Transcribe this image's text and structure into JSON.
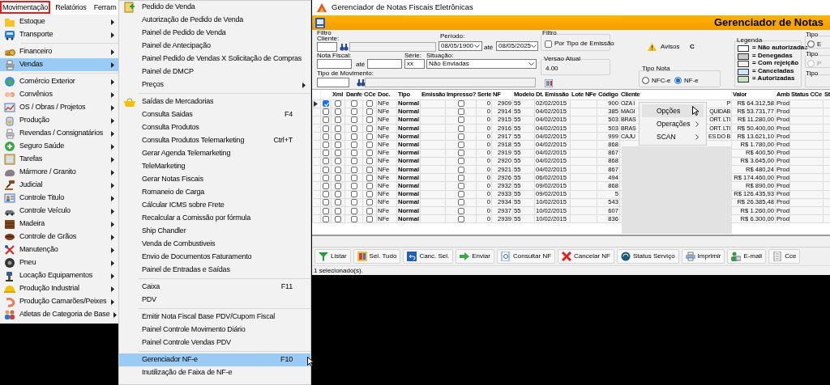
{
  "menubar": [
    {
      "label": "Movimentação",
      "selected": true
    },
    {
      "label": "Relatórios",
      "selected": false
    },
    {
      "label": "Ferram",
      "selected": false
    }
  ],
  "main_menu": [
    {
      "kind": "item",
      "label": "Estoque",
      "has_submenu": true,
      "selected": false
    },
    {
      "kind": "item",
      "label": "Transporte",
      "has_submenu": true,
      "selected": false
    },
    {
      "kind": "separator"
    },
    {
      "kind": "item",
      "label": "Financeiro",
      "has_submenu": true,
      "selected": false
    },
    {
      "kind": "item",
      "label": "Vendas",
      "has_submenu": true,
      "selected": true
    },
    {
      "kind": "separator"
    },
    {
      "kind": "item",
      "label": "Comércio Exterior",
      "has_submenu": true,
      "selected": false
    },
    {
      "kind": "item",
      "label": "Convênios",
      "has_submenu": true,
      "selected": false
    },
    {
      "kind": "item",
      "label": "OS / Obras / Projetos",
      "has_submenu": true,
      "selected": false
    },
    {
      "kind": "item",
      "label": "Produção",
      "has_submenu": true,
      "selected": false
    },
    {
      "kind": "item",
      "label": "Revendas / Consignatários",
      "has_submenu": true,
      "selected": false
    },
    {
      "kind": "item",
      "label": "Seguro Saúde",
      "has_submenu": true,
      "selected": false
    },
    {
      "kind": "item",
      "label": "Tarefas",
      "has_submenu": true,
      "selected": false
    },
    {
      "kind": "item",
      "label": "Mármore / Granito",
      "has_submenu": true,
      "selected": false
    },
    {
      "kind": "item",
      "label": "Judicial",
      "has_submenu": true,
      "selected": false
    },
    {
      "kind": "item",
      "label": "Controle Titulo",
      "has_submenu": true,
      "selected": false
    },
    {
      "kind": "item",
      "label": "Controle Veículo",
      "has_submenu": true,
      "selected": false
    },
    {
      "kind": "item",
      "label": "Madeira",
      "has_submenu": true,
      "selected": false
    },
    {
      "kind": "item",
      "label": "Controle de Grãos",
      "has_submenu": true,
      "selected": false
    },
    {
      "kind": "item",
      "label": "Manutenção",
      "has_submenu": true,
      "selected": false
    },
    {
      "kind": "item",
      "label": "Pneu",
      "has_submenu": true,
      "selected": false
    },
    {
      "kind": "item",
      "label": "Locação Equipamentos",
      "has_submenu": true,
      "selected": false
    },
    {
      "kind": "item",
      "label": "Produção Industrial",
      "has_submenu": true,
      "selected": false
    },
    {
      "kind": "item",
      "label": "Produção Camarões/Peixes",
      "has_submenu": true,
      "selected": false
    },
    {
      "kind": "item",
      "label": "Atletas de Categoria de Base",
      "has_submenu": true,
      "selected": false
    }
  ],
  "submenu": [
    {
      "kind": "item",
      "label": "Pedido de Venda",
      "has_icon": true,
      "selected": false
    },
    {
      "kind": "item",
      "label": "Autorização de Pedido de Venda",
      "selected": false
    },
    {
      "kind": "item",
      "label": "Painel de Pedido de Venda",
      "selected": false
    },
    {
      "kind": "item",
      "label": "Painel de Antecipação",
      "selected": false
    },
    {
      "kind": "item",
      "label": "Painel Pedido de Vendas X Solicitação de Compras",
      "selected": false
    },
    {
      "kind": "item",
      "label": "Painel de DMCP",
      "selected": false
    },
    {
      "kind": "item",
      "label": "Preços",
      "has_submenu": true,
      "selected": false
    },
    {
      "kind": "separator"
    },
    {
      "kind": "item",
      "label": "Saídas de Mercadorias",
      "has_icon": true,
      "selected": false
    },
    {
      "kind": "item",
      "label": "Consulta Saidas",
      "shortcut": "F4",
      "selected": false
    },
    {
      "kind": "item",
      "label": "Consulta Produtos",
      "selected": false
    },
    {
      "kind": "item",
      "label": "Consulta Produtos Telemarketing",
      "shortcut": "Ctrl+T",
      "selected": false
    },
    {
      "kind": "item",
      "label": "Gerar Agenda Telemarketing",
      "selected": false
    },
    {
      "kind": "item",
      "label": "TeleMarketing",
      "selected": false
    },
    {
      "kind": "item",
      "label": "Gerar Notas Fiscais",
      "selected": false
    },
    {
      "kind": "item",
      "label": "Romaneio de Carga",
      "selected": false
    },
    {
      "kind": "item",
      "label": "Cálcular ICMS sobre Frete",
      "selected": false
    },
    {
      "kind": "item",
      "label": "Recalcular a Comissão por fórmula",
      "selected": false
    },
    {
      "kind": "item",
      "label": "Ship Chandler",
      "selected": false
    },
    {
      "kind": "item",
      "label": "Venda de Combustiveis",
      "selected": false
    },
    {
      "kind": "item",
      "label": "Envio de Documentos Faturamento",
      "selected": false
    },
    {
      "kind": "item",
      "label": "Painel de Entradas e Saídas",
      "selected": false
    },
    {
      "kind": "separator"
    },
    {
      "kind": "item",
      "label": "Caixa",
      "shortcut": "F11",
      "selected": false
    },
    {
      "kind": "item",
      "label": "PDV",
      "selected": false
    },
    {
      "kind": "separator"
    },
    {
      "kind": "item",
      "label": "Emitir Nota Fiscal Base PDV/Cupom Fiscal",
      "selected": false
    },
    {
      "kind": "item",
      "label": "Painel Controle Movimento Diário",
      "selected": false
    },
    {
      "kind": "item",
      "label": "Painel Controle Vendas PDV",
      "selected": false
    },
    {
      "kind": "separator"
    },
    {
      "kind": "item",
      "label": "Gerenciador NF-e",
      "shortcut": "F10",
      "selected": true
    },
    {
      "kind": "item",
      "label": "Inutilização de Faixa de NF-e",
      "selected": false
    }
  ],
  "window": {
    "title": "Gerenciador de Notas Fiscais Eletrônicas",
    "header": "Gerenciador de Notas",
    "filter": {
      "group_label": "Filtro",
      "cliente_label": "Cliente:",
      "periodo_label": "Período:",
      "date_from": "08/05/1900",
      "ate_1": "até",
      "date_to": "08/05/2025",
      "emission_group": "Filtro",
      "emission_checkbox": {
        "label": "Por Tipo de Emissão",
        "checked": false
      },
      "nota_label": "Nota Fiscal:",
      "ate_2": "até",
      "serie_label": "Série:",
      "serie_value": "xx",
      "situacao_label": "Situação:",
      "situacao_value": "Não Enviadas",
      "versao_group": "Versao Atual",
      "versao_value": "4.00",
      "movimento_label": "Tipo de Movimento:",
      "avisos": "Avisos",
      "avisos_value": "C",
      "tipo_nota": {
        "label": "Tipo Nota",
        "options": [
          {
            "label": "NFC-e",
            "selected": false
          },
          {
            "label": "NF-e",
            "selected": true
          }
        ]
      },
      "legend": {
        "label": "Legenda",
        "items": [
          {
            "label": "= Não autorizadas",
            "color": "#ffffff"
          },
          {
            "label": "= Denegadas",
            "color": "#c8c8c8"
          },
          {
            "label": "= Com rejeição",
            "color": "#f0f0f0"
          },
          {
            "label": "= Canceladas",
            "color": "#cfe5fa"
          },
          {
            "label": "= Autorizadas",
            "color": "#c6e6c6"
          }
        ]
      },
      "side_groups": [
        {
          "label": "Tipo",
          "option": {
            "label": "E",
            "disabled": false,
            "selected": false
          }
        },
        {
          "label": "Tipo",
          "option": {
            "label": "P",
            "disabled": true,
            "selected": false
          }
        },
        {
          "label": "Tipo"
        }
      ]
    },
    "table": {
      "columns": [
        "Xml",
        "Danfe",
        "CCe",
        "Doc.",
        "Tipo",
        "Emissão",
        "Impresso?",
        "Serie",
        "NF",
        "Modelo",
        "Dt. Emissão",
        "Lote NFe",
        "Código",
        "Cliente",
        "Valor",
        "Amb",
        "Status CCe",
        "St"
      ],
      "rows": [
        {
          "current": true,
          "selected": true,
          "xml": false,
          "danfe": false,
          "cce": false,
          "doc": "NFe",
          "tipo": "Normal",
          "impresso": false,
          "serie": "0",
          "nf": "2909",
          "modelo": "55",
          "dt_emissao": "02/02/2015",
          "codigo": "900",
          "cliente": "OZA I",
          "cliente_tail": "P",
          "valor": "R$ 64.312,58",
          "amb": "Prod"
        },
        {
          "current": false,
          "selected": false,
          "xml": false,
          "danfe": false,
          "cce": false,
          "doc": "NFe",
          "tipo": "Normal",
          "impresso": false,
          "serie": "0",
          "nf": "2914",
          "modelo": "55",
          "dt_emissao": "04/02/2015",
          "codigo": "385",
          "cliente": "MAGI",
          "cliente_tail": "QUIDAB",
          "valor": "R$ 53.731,77",
          "amb": "Prod"
        },
        {
          "current": false,
          "selected": false,
          "xml": false,
          "danfe": false,
          "cce": false,
          "doc": "NFe",
          "tipo": "Normal",
          "impresso": false,
          "serie": "0",
          "nf": "2915",
          "modelo": "55",
          "dt_emissao": "04/02/2015",
          "codigo": "503",
          "cliente": "BRAS",
          "cliente_tail": "ORT. LTI",
          "valor": "R$ 11.280,00",
          "amb": "Prod"
        },
        {
          "current": false,
          "selected": false,
          "xml": false,
          "danfe": false,
          "cce": false,
          "doc": "NFe",
          "tipo": "Normal",
          "impresso": false,
          "serie": "0",
          "nf": "2916",
          "modelo": "55",
          "dt_emissao": "04/02/2015",
          "codigo": "503",
          "cliente": "BRAS",
          "cliente_tail": "ORT. LTI",
          "valor": "R$ 50.400,00",
          "amb": "Prod"
        },
        {
          "current": false,
          "selected": false,
          "xml": false,
          "danfe": false,
          "cce": false,
          "doc": "NFe",
          "tipo": "Normal",
          "impresso": false,
          "serie": "0",
          "nf": "2917",
          "modelo": "55",
          "dt_emissao": "04/02/2015",
          "codigo": "999",
          "cliente": "CAJU",
          "cliente_tail": "ES DO B",
          "valor": "R$ 13.621,10",
          "amb": "Prod"
        },
        {
          "current": false,
          "selected": false,
          "xml": false,
          "danfe": false,
          "cce": false,
          "doc": "NFe",
          "tipo": "Normal",
          "impresso": false,
          "serie": "0",
          "nf": "2918",
          "modelo": "55",
          "dt_emissao": "04/02/2015",
          "codigo": "868",
          "valor": "R$ 1.780,00",
          "amb": "Prod"
        },
        {
          "current": false,
          "selected": false,
          "xml": false,
          "danfe": false,
          "cce": false,
          "doc": "NFe",
          "tipo": "Normal",
          "impresso": false,
          "serie": "0",
          "nf": "2919",
          "modelo": "55",
          "dt_emissao": "04/02/2015",
          "codigo": "867",
          "valor": "R$ 400,50",
          "amb": "Prod"
        },
        {
          "current": false,
          "selected": false,
          "xml": false,
          "danfe": false,
          "cce": false,
          "doc": "NFe",
          "tipo": "Normal",
          "impresso": false,
          "serie": "0",
          "nf": "2920",
          "modelo": "55",
          "dt_emissao": "04/02/2015",
          "codigo": "868",
          "valor": "R$ 3.645,00",
          "amb": "Prod"
        },
        {
          "current": false,
          "selected": false,
          "xml": false,
          "danfe": false,
          "cce": false,
          "doc": "NFe",
          "tipo": "Normal",
          "impresso": false,
          "serie": "0",
          "nf": "2921",
          "modelo": "55",
          "dt_emissao": "04/02/2015",
          "codigo": "867",
          "valor": "R$ 480,24",
          "amb": "Prod"
        },
        {
          "current": false,
          "selected": false,
          "xml": false,
          "danfe": false,
          "cce": false,
          "doc": "NFe",
          "tipo": "Normal",
          "impresso": false,
          "serie": "0",
          "nf": "2926",
          "modelo": "55",
          "dt_emissao": "06/02/2015",
          "codigo": "494",
          "valor": "R$ 174.460,00",
          "amb": "Prod"
        },
        {
          "current": false,
          "selected": false,
          "xml": false,
          "danfe": false,
          "cce": false,
          "doc": "NFe",
          "tipo": "Normal",
          "impresso": false,
          "serie": "0",
          "nf": "2932",
          "modelo": "55",
          "dt_emissao": "09/02/2015",
          "codigo": "868",
          "valor": "R$ 890,00",
          "amb": "Prod"
        },
        {
          "current": false,
          "selected": false,
          "xml": false,
          "danfe": false,
          "cce": false,
          "doc": "NFe",
          "tipo": "Normal",
          "impresso": false,
          "serie": "0",
          "nf": "2933",
          "modelo": "55",
          "dt_emissao": "09/02/2015",
          "codigo": "5",
          "valor": "R$ 126.435,93",
          "amb": "Prod"
        },
        {
          "current": false,
          "selected": false,
          "xml": false,
          "danfe": false,
          "cce": false,
          "doc": "NFe",
          "tipo": "Normal",
          "impresso": false,
          "serie": "0",
          "nf": "2934",
          "modelo": "55",
          "dt_emissao": "10/02/2015",
          "codigo": "543",
          "valor": "R$ 26.385,48",
          "amb": "Prod"
        },
        {
          "current": false,
          "selected": false,
          "xml": false,
          "danfe": false,
          "cce": false,
          "doc": "NFe",
          "tipo": "Normal",
          "impresso": false,
          "serie": "0",
          "nf": "2937",
          "modelo": "55",
          "dt_emissao": "10/02/2015",
          "codigo": "607",
          "valor": "R$ 1.260,00",
          "amb": "Prod"
        },
        {
          "current": false,
          "selected": false,
          "xml": false,
          "danfe": false,
          "cce": false,
          "doc": "NFe",
          "tipo": "Normal",
          "impresso": false,
          "serie": "0",
          "nf": "2939",
          "modelo": "55",
          "dt_emissao": "10/02/2015",
          "codigo": "836",
          "valor": "R$ 6.300,00",
          "amb": "Prod"
        }
      ]
    },
    "context_menu": [
      {
        "label": "Opções",
        "has_submenu": false,
        "selected": true
      },
      {
        "label": "Operações",
        "has_submenu": true,
        "selected": false
      },
      {
        "label": "SCAN",
        "has_submenu": true,
        "selected": false
      }
    ],
    "toolbar": [
      {
        "label": "Listar"
      },
      {
        "label": "Sel. Tudo"
      },
      {
        "label": "Canc. Sel."
      },
      {
        "label": "Enviar"
      },
      {
        "label": "Consultar NF"
      },
      {
        "label": "Cancelar NF"
      },
      {
        "label": "Status Serviço"
      },
      {
        "label": "Imprimir"
      },
      {
        "label": "E-mail"
      },
      {
        "label": "Cce"
      }
    ],
    "status_bar": "1 selecionado(s)."
  }
}
